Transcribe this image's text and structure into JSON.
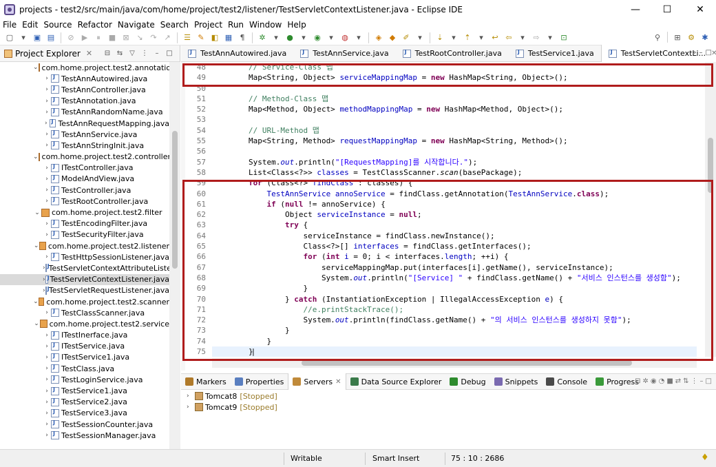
{
  "window": {
    "title": "projects - test2/src/main/java/com/home/project/test2/listener/TestServletContextListener.java - Eclipse IDE",
    "controls": {
      "minimize": "—",
      "maximize": "☐",
      "close": "✕"
    }
  },
  "menu": [
    "File",
    "Edit",
    "Source",
    "Refactor",
    "Navigate",
    "Search",
    "Project",
    "Run",
    "Window",
    "Help"
  ],
  "explorer": {
    "title": "Project Explorer",
    "close": "✕",
    "tree": [
      {
        "type": "pkg",
        "label": "com.home.project.test2.annotation"
      },
      {
        "type": "file",
        "label": "TestAnnAutowired.java"
      },
      {
        "type": "file",
        "label": "TestAnnController.java"
      },
      {
        "type": "file",
        "label": "TestAnnotation.java"
      },
      {
        "type": "file",
        "label": "TestAnnRandomName.java"
      },
      {
        "type": "file",
        "label": "TestAnnRequestMapping.java"
      },
      {
        "type": "file",
        "label": "TestAnnService.java"
      },
      {
        "type": "file",
        "label": "TestAnnStringInit.java"
      },
      {
        "type": "pkg",
        "label": "com.home.project.test2.controller"
      },
      {
        "type": "file",
        "label": "ITestController.java"
      },
      {
        "type": "file",
        "label": "ModelAndView.java"
      },
      {
        "type": "file",
        "label": "TestController.java"
      },
      {
        "type": "file",
        "label": "TestRootController.java"
      },
      {
        "type": "pkg",
        "label": "com.home.project.test2.filter"
      },
      {
        "type": "file",
        "label": "TestEncodingFilter.java"
      },
      {
        "type": "file",
        "label": "TestSecurityFilter.java"
      },
      {
        "type": "pkg",
        "label": "com.home.project.test2.listener"
      },
      {
        "type": "file",
        "label": "TestHttpSessionListener.java"
      },
      {
        "type": "file",
        "label": "TestServletContextAttributeListe"
      },
      {
        "type": "file",
        "label": "TestServletContextListener.java",
        "selected": true
      },
      {
        "type": "file",
        "label": "TestServletRequestListener.java"
      },
      {
        "type": "pkg",
        "label": "com.home.project.test2.scanner"
      },
      {
        "type": "file",
        "label": "TestClassScanner.java"
      },
      {
        "type": "pkg",
        "label": "com.home.project.test2.service"
      },
      {
        "type": "file",
        "label": "ITestInerface.java"
      },
      {
        "type": "file",
        "label": "ITestService.java"
      },
      {
        "type": "file",
        "label": "ITestService1.java"
      },
      {
        "type": "file",
        "label": "TestClass.java"
      },
      {
        "type": "file",
        "label": "TestLoginService.java"
      },
      {
        "type": "file",
        "label": "TestService1.java"
      },
      {
        "type": "file",
        "label": "TestService2.java"
      },
      {
        "type": "file",
        "label": "TestService3.java"
      },
      {
        "type": "file",
        "label": "TestSessionCounter.java"
      },
      {
        "type": "file",
        "label": "TestSessionManager.java"
      }
    ]
  },
  "editor": {
    "tabs": [
      {
        "label": "TestAnnAutowired.java"
      },
      {
        "label": "TestAnnService.java"
      },
      {
        "label": "TestRootController.java"
      },
      {
        "label": "TestService1.java"
      },
      {
        "label": "TestServletContextLi...",
        "active": true
      }
    ],
    "lines": [
      {
        "n": "48",
        "html": "        <span class='cm'>// Service-Class 맵</span>"
      },
      {
        "n": "49",
        "html": "        Map&lt;String, Object&gt; <span class='fd'>serviceMappingMap</span> = <span class='kw'>new</span> HashMap&lt;String, Object&gt;();"
      },
      {
        "n": "50",
        "html": ""
      },
      {
        "n": "51",
        "html": "        <span class='cm'>// Method-Class 맵</span>"
      },
      {
        "n": "52",
        "html": "        Map&lt;Method, Object&gt; <span class='fd'>methodMappingMap</span> = <span class='kw'>new</span> HashMap&lt;Method, Object&gt;();"
      },
      {
        "n": "53",
        "html": ""
      },
      {
        "n": "54",
        "html": "        <span class='cm'>// URL-Method 맵</span>"
      },
      {
        "n": "55",
        "html": "        Map&lt;String, Method&gt; <span class='fd'>requestMappingMap</span> = <span class='kw'>new</span> HashMap&lt;String, Method&gt;();"
      },
      {
        "n": "56",
        "html": ""
      },
      {
        "n": "57",
        "html": "        System.<span class='sf'>out</span>.println(<span class='st'>\"[RequestMapping]를 시작합니다.\"</span>);"
      },
      {
        "n": "58",
        "html": "        List&lt;Class&lt;?&gt;&gt; <span class='fd'>classes</span> = TestClassScanner.<span class='it'>scan</span>(basePackage);"
      },
      {
        "n": "59",
        "html": "        <span class='kw'>for</span> (Class&lt;?&gt; <span class='fd'>findClass</span> : classes) {"
      },
      {
        "n": "60",
        "html": "            <span class='ty'>TestAnnService</span> <span class='fd'>annoService</span> = findClass.getAnnotation(<span class='ty'>TestAnnService</span>.<span class='kw'>class</span>);"
      },
      {
        "n": "61",
        "html": "            <span class='kw'>if</span> (<span class='kw'>null</span> != annoService) {"
      },
      {
        "n": "62",
        "html": "                Object <span class='fd'>serviceInstance</span> = <span class='kw'>null</span>;"
      },
      {
        "n": "63",
        "html": "                <span class='kw'>try</span> {"
      },
      {
        "n": "64",
        "html": "                    serviceInstance = findClass.newInstance();"
      },
      {
        "n": "65",
        "html": "                    Class&lt;?&gt;[] <span class='fd'>interfaces</span> = findClass.getInterfaces();"
      },
      {
        "n": "66",
        "html": "                    <span class='kw'>for</span> (<span class='kw'>int</span> <span class='fd'>i</span> = 0; i &lt; interfaces.<span class='fd'>length</span>; ++i) {"
      },
      {
        "n": "67",
        "html": "                        serviceMappingMap.put(interfaces[i].getName(), serviceInstance);"
      },
      {
        "n": "68",
        "html": "                        System.<span class='sf'>out</span>.println(<span class='st'>\"[Service] \"</span> + findClass.getName() + <span class='st'>\"서비스 인스턴스를 생성함\"</span>);"
      },
      {
        "n": "69",
        "html": "                    }"
      },
      {
        "n": "70",
        "html": "                } <span class='kw'>catch</span> (InstantiationException | IllegalAccessException <span class='fd'>e</span>) {"
      },
      {
        "n": "71",
        "html": "                    <span class='cm'>//e.printStackTrace();</span>"
      },
      {
        "n": "72",
        "html": "                    System.<span class='sf'>out</span>.println(findClass.getName() + <span class='st'>\"의 서비스 인스턴스를 생성하지 못함\"</span>);"
      },
      {
        "n": "73",
        "html": "                }"
      },
      {
        "n": "74",
        "html": "            }"
      },
      {
        "n": "75",
        "html": "        }",
        "current": true
      }
    ]
  },
  "bottom": {
    "tabs": [
      {
        "label": "Markers"
      },
      {
        "label": "Properties"
      },
      {
        "label": "Servers",
        "active": true
      },
      {
        "label": "Data Source Explorer"
      },
      {
        "label": "Debug"
      },
      {
        "label": "Snippets"
      },
      {
        "label": "Console"
      },
      {
        "label": "Progress"
      }
    ],
    "servers": [
      {
        "name": "Tomcat8",
        "state": "[Stopped]"
      },
      {
        "name": "Tomcat9",
        "state": "[Stopped]"
      }
    ]
  },
  "status": {
    "mode": "Writable",
    "insert": "Smart Insert",
    "position": "75 : 10 : 2686"
  },
  "colors": {
    "highlight_box": "#b01c1c",
    "keyword": "#7f0055",
    "comment": "#3f7f5f",
    "string": "#2a00ff",
    "field": "#0000c0"
  }
}
